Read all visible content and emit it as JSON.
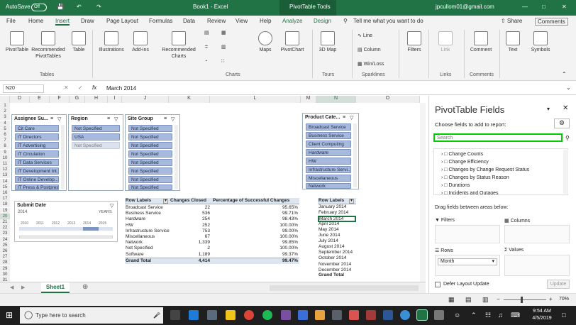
{
  "title_bar": {
    "autosave_label": "AutoSave",
    "autosave_state": "Off",
    "document_title": "Book1 - Excel",
    "context_tab": "PivotTable Tools",
    "user": "jpcullom01@gmail.com"
  },
  "tabs": [
    "File",
    "Home",
    "Insert",
    "Draw",
    "Page Layout",
    "Formulas",
    "Data",
    "Review",
    "View",
    "Help",
    "Analyze",
    "Design"
  ],
  "tell_me": "Tell me what you want to do",
  "share_label": "Share",
  "comments_label": "Comments",
  "ribbon": {
    "pivottable": "PivotTable",
    "recommended_pivottables": "Recommended PivotTables",
    "table": "Table",
    "group_tables": "Tables",
    "illustrations": "Illustrations",
    "addins": "Add-ins",
    "recommended_charts": "Recommended Charts",
    "maps": "Maps",
    "pivotchart": "PivotChart",
    "group_charts": "Charts",
    "map3d": "3D Map",
    "group_tours": "Tours",
    "line": "Line",
    "column": "Column",
    "winloss": "Win/Loss",
    "group_sparklines": "Sparklines",
    "filters": "Filters",
    "link": "Link",
    "group_links": "Links",
    "comment": "Comment",
    "group_comments": "Comments",
    "text": "Text",
    "symbols": "Symbols"
  },
  "formula_bar": {
    "name_box": "N20",
    "fx": "fx",
    "value": "March 2014"
  },
  "columns": [
    "D",
    "E",
    "F",
    "G",
    "H",
    "I",
    "J",
    "K",
    "L",
    "M",
    "N",
    "O"
  ],
  "rows": [
    "1",
    "2",
    "3",
    "4",
    "5",
    "6",
    "7",
    "8",
    "9",
    "10",
    "11",
    "12",
    "13",
    "14",
    "15",
    "16",
    "17",
    "18",
    "19",
    "20",
    "21",
    "22",
    "23",
    "24",
    "25",
    "26",
    "27",
    "28",
    "29",
    "30",
    "31"
  ],
  "slicers": {
    "assignee": {
      "title": "Assignee Su...",
      "items": [
        "Cit Care",
        "IT Directors",
        "IT Advertising",
        "IT Circulation",
        "IT Data Services",
        "IT Development Int...",
        "IT Online Develop...",
        "IT Press & Postpress"
      ]
    },
    "region": {
      "title": "Region",
      "items": [
        "Not Specified",
        "USA",
        "Not Specified"
      ]
    },
    "site_group": {
      "title": "Site Group",
      "items": [
        "Not Specified",
        "Not Specified",
        "Not Specified",
        "Not Specified",
        "Not Specified",
        "Not Specified",
        "Not Specified",
        "Not Specified"
      ]
    },
    "product": {
      "title": "Product Cate...",
      "items": [
        "Broadcast Service",
        "Business Service",
        "Client Computing",
        "Hardware",
        "HW",
        "Infrastructure Servi...",
        "Miscellaneous",
        "Network"
      ]
    }
  },
  "timeline": {
    "title": "Submit Date",
    "year": "2014",
    "unit": "YEARS",
    "years": [
      "2010",
      "2011",
      "2012",
      "2013",
      "2014",
      "2015"
    ]
  },
  "pivot": {
    "headers": [
      "Row Labels",
      "Changes Closed",
      "Percentage of Successful Changes"
    ],
    "rows": [
      [
        "Broadcast Service",
        "22",
        "95.65%"
      ],
      [
        "Business Service",
        "536",
        "99.71%"
      ],
      [
        "Hardware",
        "254",
        "98.43%"
      ],
      [
        "HW",
        "252",
        "100.00%"
      ],
      [
        "Infrastructure Service",
        "753",
        "99.00%"
      ],
      [
        "Miscellaneous",
        "67",
        "100.00%"
      ],
      [
        "Network",
        "1,339",
        "99.85%"
      ],
      [
        "Not Specified",
        "2",
        "100.00%"
      ],
      [
        "Software",
        "1,189",
        "99.37%"
      ]
    ],
    "total": [
      "Grand Total",
      "4,414",
      "99.47%"
    ]
  },
  "months_pivot": {
    "header": "Row Labels",
    "months": [
      "January 2014",
      "February 2014",
      "March 2014",
      "April 2014",
      "May 2014",
      "June 2014",
      "July 2014",
      "August 2014",
      "September 2014",
      "October 2014",
      "November 2014",
      "December 2014"
    ],
    "total": "Grand Total"
  },
  "sheet_tab": "Sheet1",
  "pane": {
    "title": "PivotTable Fields",
    "subtitle": "Choose fields to add to report:",
    "search_placeholder": "Search",
    "fields": [
      "Change Counts",
      "Change Efficiency",
      "Changes by Change Request Status",
      "Changes by Status Reason",
      "Durations",
      "Incidents and Outages"
    ],
    "drag_label": "Drag fields between areas below:",
    "filters": "Filters",
    "columns": "Columns",
    "rows": "Rows",
    "values": "Values",
    "rows_value": "Month",
    "defer": "Defer Layout Update",
    "update": "Update"
  },
  "status": {
    "zoom": "70%"
  },
  "taskbar": {
    "search": "Type here to search",
    "time": "9:54 AM",
    "date": "4/5/2019"
  },
  "colors": {
    "excel_green": "#217346",
    "slicer_selected": "#a7b9dc",
    "highlight": "#00cc00"
  }
}
